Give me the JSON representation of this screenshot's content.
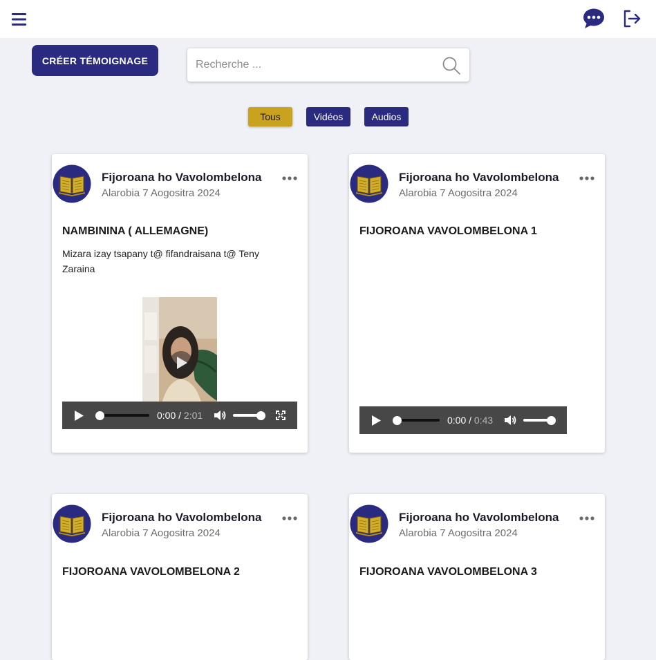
{
  "topbar": {
    "menu_icon": "hamburger-menu-icon",
    "chat_icon": "chat-bubble-icon",
    "logout_icon": "logout-icon"
  },
  "toolbar": {
    "create_label": "CRÉER TÉMOIGNAGE",
    "search_placeholder": "Recherche ...",
    "search_value": ""
  },
  "filters": {
    "all": "Tous",
    "videos": "Vidéos",
    "audios": "Audios",
    "active": "all"
  },
  "posts": [
    {
      "author": "Fijoroana ho Vavolombelona",
      "date": "Alarobia 7 Aogositra 2024",
      "title": "NAMBININA ( ALLEMAGNE)",
      "description": "Mizara izay tsapany t@ fifandraisana t@ Teny Zaraina",
      "media": {
        "type": "video",
        "current": "0:00",
        "duration": "2:01"
      }
    },
    {
      "author": "Fijoroana ho Vavolombelona",
      "date": "Alarobia 7 Aogositra 2024",
      "title": "FIJOROANA VAVOLOMBELONA 1",
      "description": "",
      "media": {
        "type": "audio",
        "current": "0:00",
        "duration": "0:43"
      }
    },
    {
      "author": "Fijoroana ho Vavolombelona",
      "date": "Alarobia 7 Aogositra 2024",
      "title": "FIJOROANA VAVOLOMBELONA 2",
      "description": ""
    },
    {
      "author": "Fijoroana ho Vavolombelona",
      "date": "Alarobia 7 Aogositra 2024",
      "title": "FIJOROANA VAVOLOMBELONA 3",
      "description": ""
    }
  ],
  "colors": {
    "brand": "#2a2a80",
    "active_filter": "#c9a21e",
    "background": "#eff1f6",
    "player_bar": "#474747"
  }
}
